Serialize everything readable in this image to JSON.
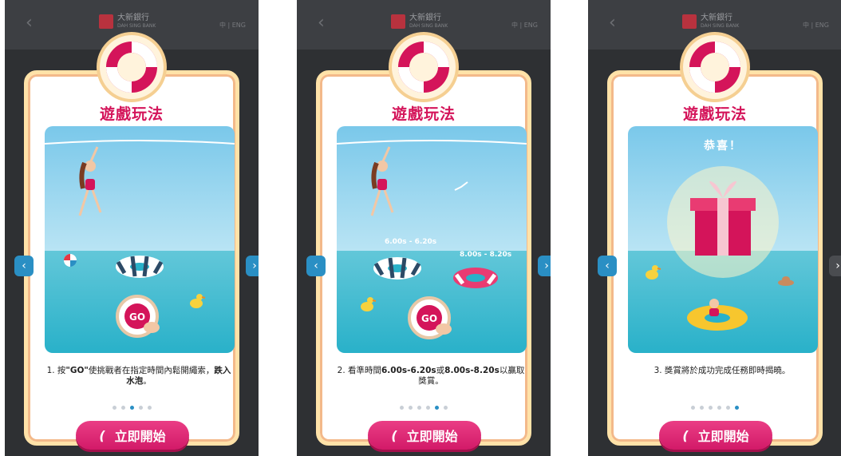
{
  "header": {
    "back_icon": "chevron-left-icon",
    "brand_cn": "大新銀行",
    "brand_en": "DAH SING BANK",
    "lang": "中 | ENG"
  },
  "modal": {
    "title": "遊戲玩法",
    "start_label": "立即開始"
  },
  "slides": [
    {
      "caption_a": "1. 按",
      "caption_b": "\"GO\"",
      "caption_c": "使挑戰者在指定時間內鬆開繩索，",
      "caption_d": "跌入水泡",
      "caption_e": "。",
      "active_dot": 3
    },
    {
      "caption_a": "2. 看準時間",
      "caption_b": "6.00s-6.20s",
      "caption_c": "或",
      "caption_d": "8.00s-8.20s",
      "caption_e": "以贏取獎賞。",
      "time1": "6.00s - 6.20s",
      "time2": "8.00s - 8.20s",
      "active_dot": 4
    },
    {
      "caption": "3. 獎賞將於成功完成任務即時揭曉。",
      "congrats": "恭喜！",
      "active_dot": 5
    }
  ],
  "go_label": "GO",
  "colors": {
    "accent": "#d4145a",
    "nav_blue": "#2a8fc4",
    "frame": "#ffe2a8"
  }
}
